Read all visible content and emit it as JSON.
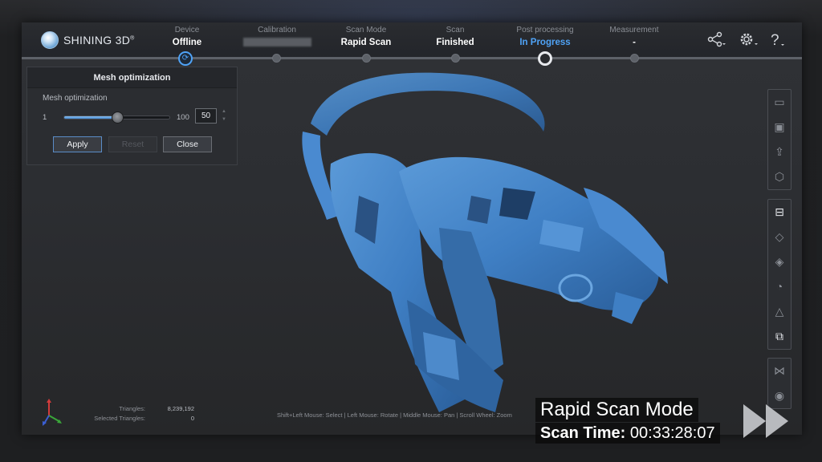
{
  "app": {
    "brand": "SHINING 3D",
    "brand_mark": "®"
  },
  "steps": [
    {
      "label": "Device",
      "value": "Offline"
    },
    {
      "label": "Calibration",
      "value": ""
    },
    {
      "label": "Scan Mode",
      "value": "Rapid Scan"
    },
    {
      "label": "Scan",
      "value": "Finished"
    },
    {
      "label": "Post processing",
      "value": "In Progress"
    },
    {
      "label": "Measurement",
      "value": "-"
    }
  ],
  "top_icons": [
    "share-icon",
    "gear-icon",
    "help-icon"
  ],
  "dialog": {
    "title": "Mesh optimization",
    "field_label": "Mesh optimization",
    "min": "1",
    "max": "100",
    "value": "50",
    "slider_fraction": 0.5,
    "apply": "Apply",
    "reset": "Reset",
    "close": "Close"
  },
  "toolbar": {
    "group1": [
      "folder-icon",
      "save-icon",
      "export-icon",
      "cube-view-icon"
    ],
    "group2": [
      "box-top-icon",
      "cube-rotate-icon",
      "cube-icon",
      "lasso-icon",
      "triangle-mesh-icon",
      "mesh-box-icon"
    ],
    "group3": [
      "flip-icon",
      "eye-icon"
    ]
  },
  "stats": {
    "triangles_label": "Triangles:",
    "triangles_value": "8,239,192",
    "selected_label": "Selected Triangles:",
    "selected_value": "0"
  },
  "hint": "Shift+Left Mouse: Select | Left Mouse: Rotate | Middle Mouse: Pan | Scroll Wheel: Zoom",
  "overlay": {
    "mode": "Rapid Scan Mode",
    "time_label": "Scan Time:",
    "time_value": "00:33:28:07"
  },
  "colors": {
    "accent": "#4fa3f7",
    "mesh": "#3f7fc4"
  }
}
